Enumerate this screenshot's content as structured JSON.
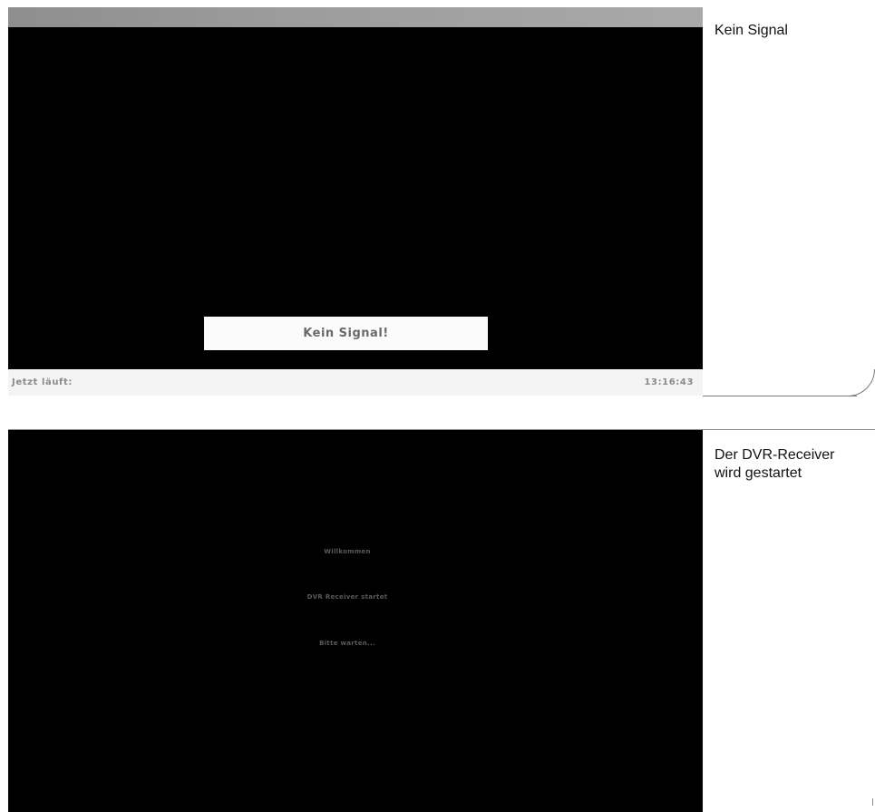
{
  "panel_no_signal": {
    "caption": "Kein Signal",
    "signal_message": "Kein Signal!",
    "now_playing_label": "Jetzt läuft:",
    "clock": "13:16:43"
  },
  "panel_startup": {
    "caption_line1": "Der DVR-Receiver",
    "caption_line2": "wird gestartet",
    "welcome": "Willkommen",
    "starting": "DVR Receiver startet",
    "please_wait": "Bitte warten..."
  }
}
